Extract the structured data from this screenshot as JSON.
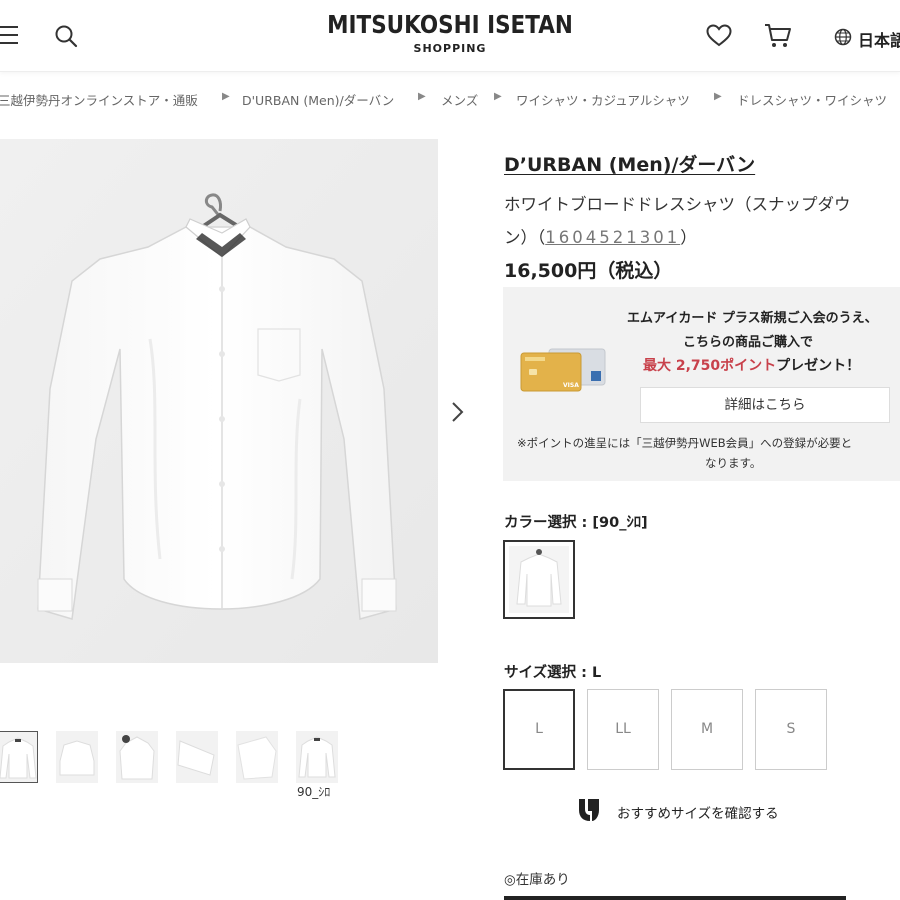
{
  "header": {
    "logo_main": "MITSUKOSHI ISETAN",
    "logo_sub": "SHOPPING",
    "language": "日本語"
  },
  "breadcrumb": [
    "三越伊勢丹オンラインストア・通販",
    "D'URBAN (Men)/ダーバン",
    "メンズ",
    "ワイシャツ・カジュアルシャツ",
    "ドレスシャツ・ワイシャツ"
  ],
  "product": {
    "brand": "D’URBAN (Men)/ダーバン",
    "name_line1": "ホワイトブロードドレスシャツ（スナップダウ",
    "name_line2_prefix": "ン）（",
    "code": "1604521301",
    "name_line2_suffix": "）",
    "price": "16,500円（税込）"
  },
  "promo": {
    "line1": "エムアイカード プラス新規ご入会のうえ、",
    "line2": "こちらの商品ご購入で",
    "highlight": "最大 2,750ポイント",
    "line3_suffix": "プレゼント！",
    "button": "詳細はこちら",
    "note1": "※ポイントの進呈には「三越伊勢丹WEB会員」への登録が必要と",
    "note2": "なります。",
    "card_label": "VISA"
  },
  "thumbnail_caption": "90_ｼﾛ",
  "color": {
    "label": "カラー選択 : [90_ｼﾛ]"
  },
  "size": {
    "label": "サイズ選択 : L",
    "options": [
      "L",
      "LL",
      "M",
      "S"
    ],
    "selected": "L"
  },
  "size_advisor": "おすすめサイズを確認する",
  "stock": "◎在庫あり",
  "colors": {
    "highlight_red": "#c8414b",
    "promo_bg": "#f2f2f2",
    "image_bg": "#eeeeee"
  }
}
